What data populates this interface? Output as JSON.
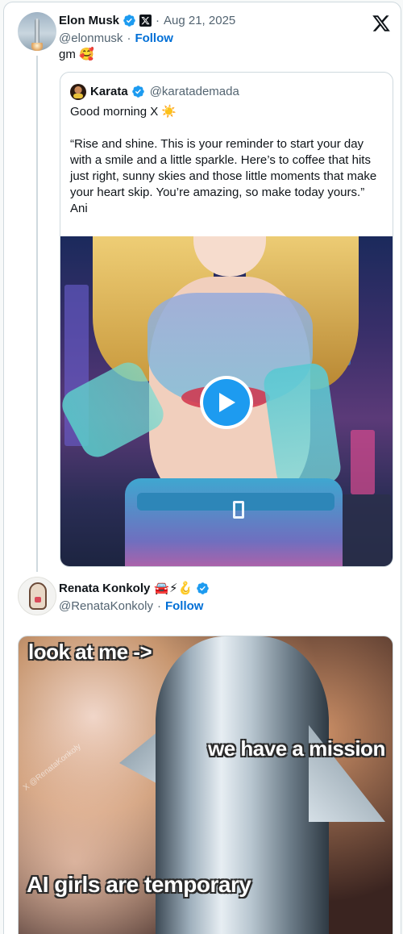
{
  "tweet": {
    "author": {
      "name": "Elon Musk",
      "handle": "@elonmusk",
      "follow": "Follow",
      "date": "Aug 21, 2025"
    },
    "text": "gm",
    "emoji": "🥰",
    "quote": {
      "author_name": "Karata",
      "author_handle": "@karatademada",
      "line1": "Good morning X",
      "line1_emoji": "☀️",
      "paragraph": "“Rise and shine. This is your reminder to start your day with a smile and a little sparkle. Here’s to coffee that hits just right, sunny skies and those little moments that make your heart skip. You’re amazing, so make today yours.”",
      "signature": "Ani"
    }
  },
  "reply": {
    "author": {
      "name": "Renata Konkoly",
      "badges": "🚘⚡🪝",
      "handle": "@RenataKonkoly",
      "follow": "Follow"
    },
    "meme": {
      "top_text": "look at me ->",
      "middle_text": "we have a mission",
      "bottom_text": "AI girls are temporary",
      "watermark": "X @RenataKonkoly"
    }
  },
  "icons": {
    "verified": "verified-badge-icon",
    "x_affiliate": "x-affiliate-icon",
    "x_logo": "x-logo-icon",
    "play": "play-icon"
  },
  "colors": {
    "link": "#006fd6",
    "verified": "#1d9bf0",
    "secondary_text": "#536471"
  }
}
